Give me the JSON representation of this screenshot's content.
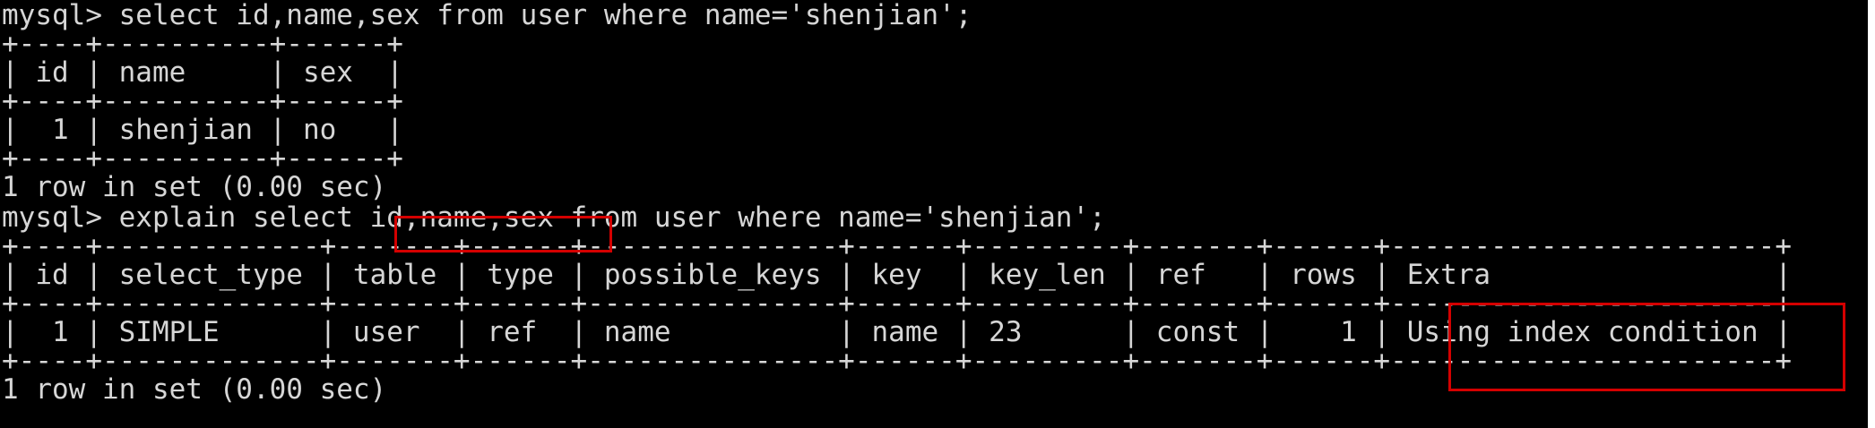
{
  "colors": {
    "background": "#000000",
    "text": "#d6d6d6",
    "highlight": "#d40000"
  },
  "terminal": {
    "lines": [
      "mysql> select id,name,sex from user where name='shenjian';",
      "+----+----------+------+",
      "| id | name     | sex  |",
      "+----+----------+------+",
      "|  1 | shenjian | no   |",
      "+----+----------+------+",
      "1 row in set (0.00 sec)",
      "",
      "mysql> explain select id,name,sex from user where name='shenjian';",
      "+----+-------------+-------+------+---------------+------+---------+-------+------+-----------------------+",
      "| id | select_type | table | type | possible_keys | key  | key_len | ref   | rows | Extra                 |",
      "+----+-------------+-------+------+---------------+------+---------+-------+------+-----------------------+",
      "|  1 | SIMPLE      | user  | ref  | name          | name | 23      | const |    1 | Using index condition |",
      "+----+-------------+-------+------+---------------+------+---------+-------+------+-----------------------+",
      "1 row in set (0.00 sec)"
    ]
  }
}
